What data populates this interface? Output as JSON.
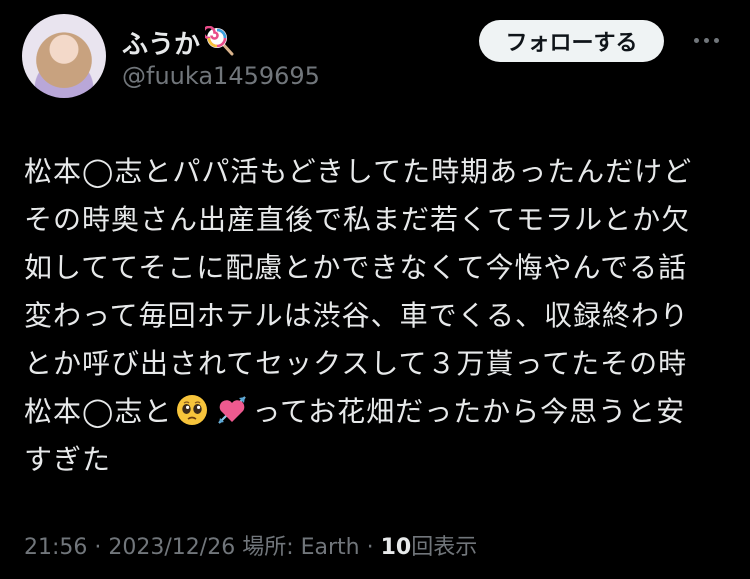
{
  "user": {
    "display_name": "ふうか",
    "handle": "@fuuka1459695",
    "name_icon": "lollipop-icon",
    "avatar": "avatar"
  },
  "header": {
    "follow_label": "フォローする",
    "more_icon": "more-icon"
  },
  "tweet": {
    "lines": [
      "松本◯志とパパ活もどきしてた時期あったんだけど",
      "その時奥さん出産直後で私まだ若くてモラルとか欠",
      "如しててそこに配慮とかできなくて今悔やんでる話",
      "変わって毎回ホテルは渋谷、車でくる、収録終わり",
      "とか呼び出されてセックスして３万貰ってたその時"
    ],
    "line6_before": "松本◯志と",
    "line6_after": "ってお花畑だったから今思うと安",
    "line7": "すぎた",
    "emoji_1": "pleading-face-icon",
    "emoji_2": "heart-with-arrow-icon"
  },
  "meta": {
    "time": "21:56",
    "sep1": " · ",
    "date": "2023/12/26",
    "location": " 場所: Earth",
    "sep2": " · ",
    "views": "10",
    "views_label": "回表示"
  }
}
